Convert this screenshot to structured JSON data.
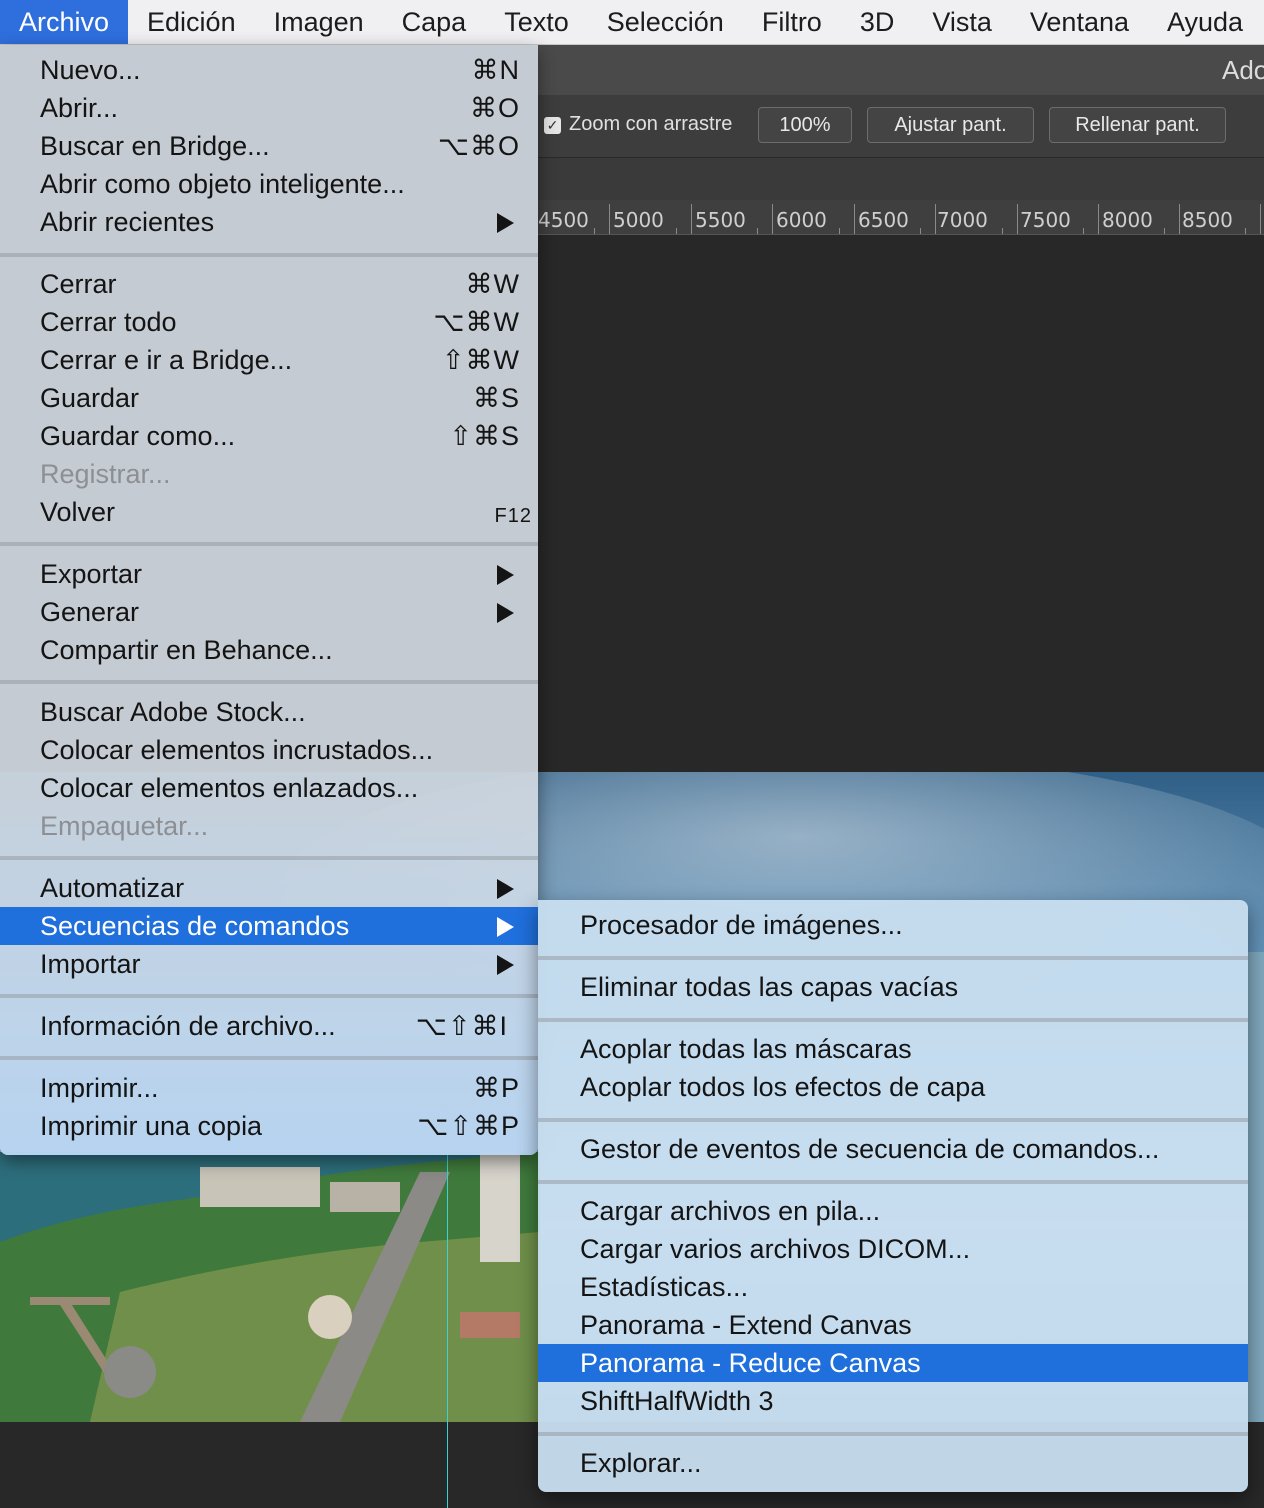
{
  "menubar": {
    "items": [
      "Archivo",
      "Edición",
      "Imagen",
      "Capa",
      "Texto",
      "Selección",
      "Filtro",
      "3D",
      "Vista",
      "Ventana",
      "Ayuda"
    ],
    "active_index": 0
  },
  "app": {
    "title_fragment": "Ado"
  },
  "options_bar": {
    "zoom_drag_label": "Zoom con arrastre",
    "zoom_drag_checked": true,
    "btn_100": "100%",
    "btn_fit": "Ajustar pant.",
    "btn_fill": "Rellenar pant."
  },
  "ruler": {
    "labels": [
      "4500",
      "5000",
      "5500",
      "6000",
      "6500",
      "7000",
      "7500",
      "8000",
      "8500"
    ]
  },
  "file_menu": {
    "items": [
      {
        "label": "Nuevo...",
        "shortcut": "⌘N"
      },
      {
        "label": "Abrir...",
        "shortcut": "⌘O"
      },
      {
        "label": "Buscar en Bridge...",
        "shortcut": "⌥⌘O"
      },
      {
        "label": "Abrir como objeto inteligente...",
        "shortcut": ""
      },
      {
        "label": "Abrir recientes",
        "submenu": true
      },
      {
        "label": "Cerrar",
        "shortcut": "⌘W"
      },
      {
        "label": "Cerrar todo",
        "shortcut": "⌥⌘W"
      },
      {
        "label": "Cerrar e ir a Bridge...",
        "shortcut": "⇧⌘W"
      },
      {
        "label": "Guardar",
        "shortcut": "⌘S"
      },
      {
        "label": "Guardar como...",
        "shortcut": "⇧⌘S"
      },
      {
        "label": "Registrar...",
        "disabled": true
      },
      {
        "label": "Volver",
        "shortcut": "F12"
      },
      {
        "label": "Exportar",
        "submenu": true
      },
      {
        "label": "Generar",
        "submenu": true
      },
      {
        "label": "Compartir en Behance..."
      },
      {
        "label": "Buscar Adobe Stock..."
      },
      {
        "label": "Colocar elementos incrustados..."
      },
      {
        "label": "Colocar elementos enlazados..."
      },
      {
        "label": "Empaquetar...",
        "disabled": true
      },
      {
        "label": "Automatizar",
        "submenu": true
      },
      {
        "label": "Secuencias de comandos",
        "submenu": true,
        "highlighted": true
      },
      {
        "label": "Importar",
        "submenu": true
      },
      {
        "label": "Información de archivo...",
        "shortcut": "⌥⇧⌘I"
      },
      {
        "label": "Imprimir...",
        "shortcut": "⌘P"
      },
      {
        "label": "Imprimir una copia",
        "shortcut": "⌥⇧⌘P"
      }
    ]
  },
  "scripts_submenu": {
    "items": [
      {
        "label": "Procesador de imágenes..."
      },
      {
        "label": "Eliminar todas las capas vacías"
      },
      {
        "label": "Acoplar todas las máscaras"
      },
      {
        "label": "Acoplar todos los efectos de capa"
      },
      {
        "label": "Gestor de eventos de secuencia de comandos..."
      },
      {
        "label": "Cargar archivos en pila..."
      },
      {
        "label": "Cargar varios archivos DICOM..."
      },
      {
        "label": "Estadísticas..."
      },
      {
        "label": "Panorama - Extend Canvas"
      },
      {
        "label": "Panorama - Reduce Canvas",
        "highlighted": true
      },
      {
        "label": "ShiftHalfWidth 3"
      },
      {
        "label": "Explorar..."
      }
    ]
  },
  "colors": {
    "selection": "#1f6fdc",
    "menubar_active": "#2f6fdd",
    "app_background": "#282828",
    "guide": "#39d3d3"
  }
}
